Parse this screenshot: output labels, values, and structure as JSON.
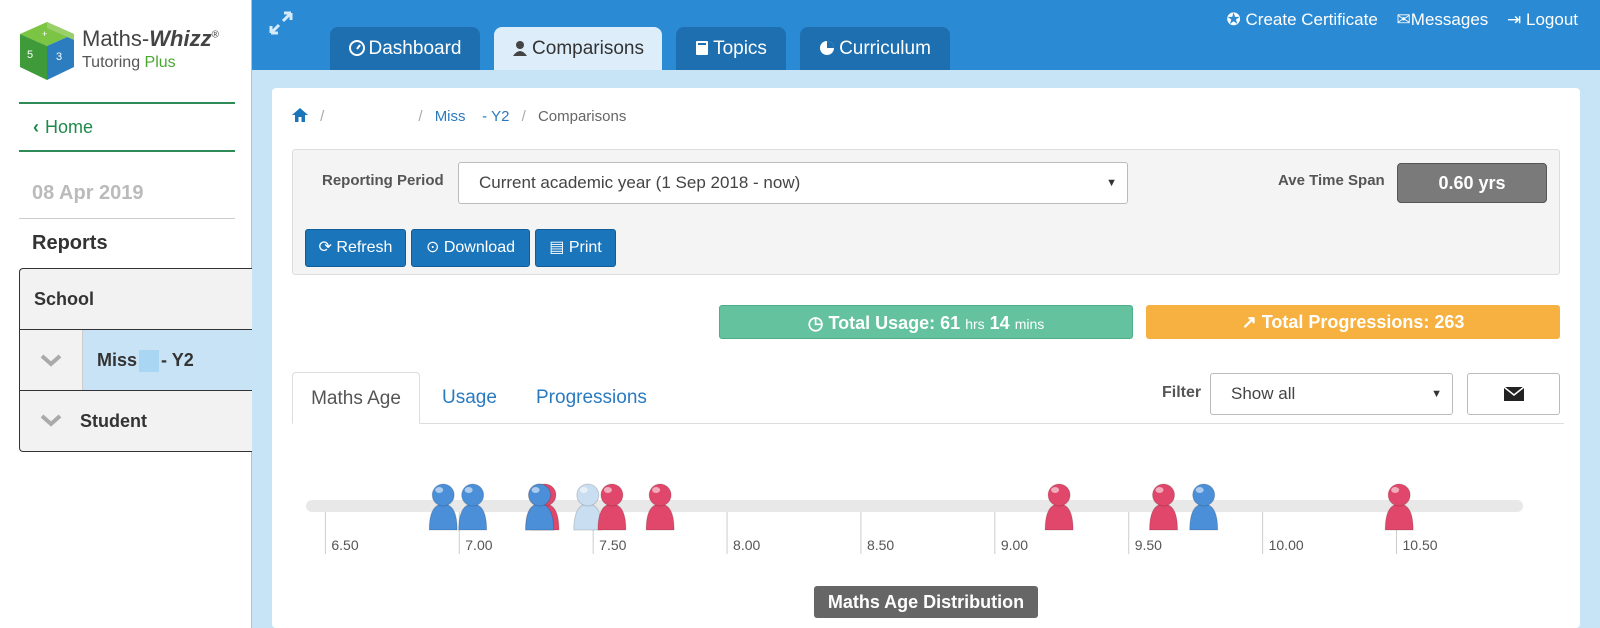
{
  "app": {
    "logo_title_prefix": "Maths-",
    "logo_title_suffix": "Whizz",
    "logo_reg": "®",
    "logo_sub_prefix": "Tutoring ",
    "logo_sub_plus": "Plus"
  },
  "sidebar": {
    "home_label": "Home",
    "date": "08 Apr 2019",
    "reports_label": "Reports",
    "tree": {
      "school": "School",
      "class_prefix": "Miss",
      "class_suffix": "- Y2",
      "student": "Student"
    }
  },
  "nav": {
    "tabs": [
      {
        "label": "Dashboard",
        "icon": "dashboard-icon"
      },
      {
        "label": "Comparisons",
        "icon": "user-icon"
      },
      {
        "label": "Topics",
        "icon": "book-icon"
      },
      {
        "label": "Curriculum",
        "icon": "pie-chart-icon"
      }
    ],
    "active_tab": "Comparisons",
    "links": {
      "certificate": "Create Certificate",
      "messages": "Messages",
      "logout": "Logout"
    }
  },
  "breadcrumb": {
    "class_link": "Miss    - Y2",
    "current": "Comparisons"
  },
  "filters": {
    "reporting_period_label": "Reporting Period",
    "reporting_period_value": "Current academic year (1 Sep 2018 - now)",
    "ave_time_span_label": "Ave Time Span",
    "ave_time_span_value": "0.60 yrs",
    "refresh_label": "Refresh",
    "download_label": "Download",
    "print_label": "Print"
  },
  "stats": {
    "usage_label": "Total Usage:",
    "usage_hrs": "61",
    "usage_hrs_unit": "hrs",
    "usage_mins": "14",
    "usage_mins_unit": "mins",
    "progressions_label": "Total Progressions: 263"
  },
  "subtabs": [
    "Maths Age",
    "Usage",
    "Progressions"
  ],
  "active_subtab": "Maths Age",
  "filter": {
    "label": "Filter",
    "value": "Show all"
  },
  "chart_data": {
    "type": "scatter",
    "title": "Maths Age Distribution",
    "x_ticks": [
      "6.50",
      "7.00",
      "7.50",
      "8.00",
      "8.50",
      "9.00",
      "9.50",
      "10.00",
      "10.50"
    ],
    "xlim": [
      6.45,
      10.95
    ],
    "series": [
      {
        "name": "blue",
        "color": "#4a8fd8",
        "x": [
          6.94,
          7.05,
          7.3,
          9.78
        ]
      },
      {
        "name": "pink",
        "color": "#e0476a",
        "x": [
          7.3,
          7.32,
          7.57,
          7.75,
          9.24,
          9.63,
          10.51
        ]
      },
      {
        "name": "faded",
        "color": "#c9def0",
        "x": [
          7.48
        ]
      }
    ]
  }
}
